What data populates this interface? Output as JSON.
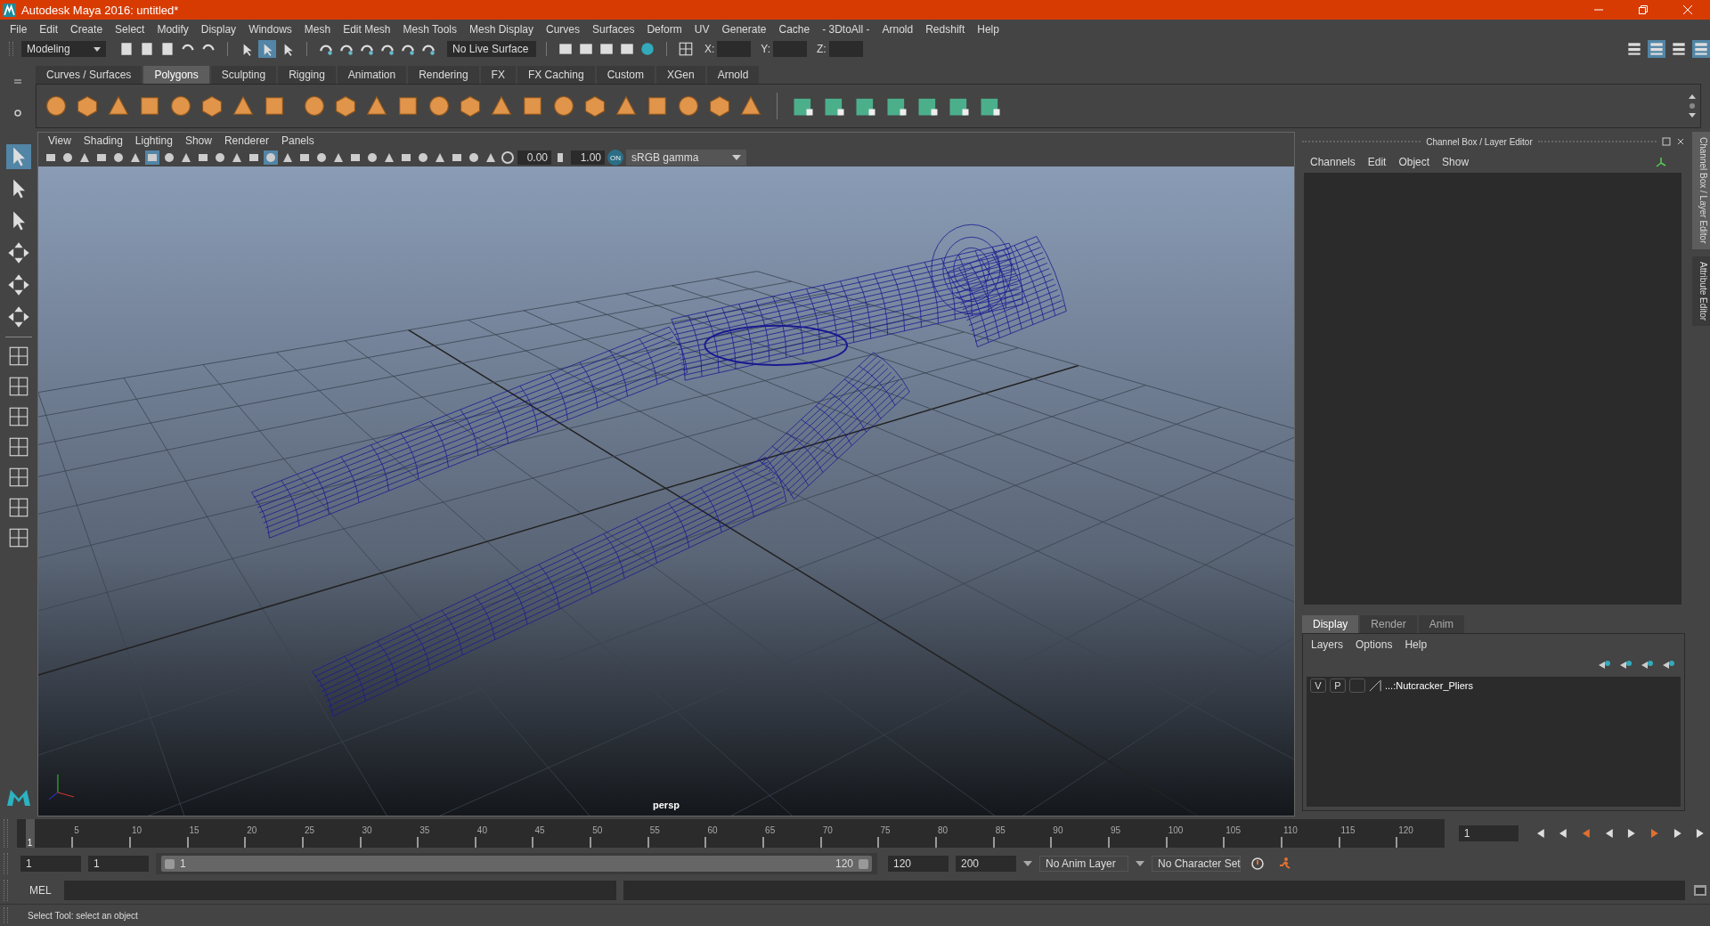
{
  "window": {
    "title": "Autodesk Maya 2016: untitled*"
  },
  "menu_bar": [
    "File",
    "Edit",
    "Create",
    "Select",
    "Modify",
    "Display",
    "Windows",
    "Mesh",
    "Edit Mesh",
    "Mesh Tools",
    "Mesh Display",
    "Curves",
    "Surfaces",
    "Deform",
    "UV",
    "Generate",
    "Cache",
    "- 3DtoAll -",
    "Arnold",
    "Redshift",
    "Help"
  ],
  "status_line": {
    "mode": "Modeling",
    "live_surface": "No Live Surface",
    "x_label": "X:",
    "y_label": "Y:",
    "z_label": "Z:"
  },
  "shelf_tabs": [
    {
      "label": "Curves / Surfaces",
      "selected": false
    },
    {
      "label": "Polygons",
      "selected": true
    },
    {
      "label": "Sculpting",
      "selected": false
    },
    {
      "label": "Rigging",
      "selected": false
    },
    {
      "label": "Animation",
      "selected": false
    },
    {
      "label": "Rendering",
      "selected": false
    },
    {
      "label": "FX",
      "selected": false
    },
    {
      "label": "FX Caching",
      "selected": false
    },
    {
      "label": "Custom",
      "selected": false
    },
    {
      "label": "XGen",
      "selected": false
    },
    {
      "label": "Arnold",
      "selected": false
    }
  ],
  "viewport": {
    "menus": [
      "View",
      "Shading",
      "Lighting",
      "Show",
      "Renderer",
      "Panels"
    ],
    "exposure": "0.00",
    "gamma": "1.00",
    "color_management": "ON",
    "color_space": "sRGB gamma",
    "camera": "persp"
  },
  "channel_box": {
    "title": "Channel Box / Layer Editor",
    "menus": [
      "Channels",
      "Edit",
      "Object",
      "Show"
    ]
  },
  "layer_editor": {
    "tabs": [
      {
        "label": "Display",
        "selected": true
      },
      {
        "label": "Render",
        "selected": false
      },
      {
        "label": "Anim",
        "selected": false
      }
    ],
    "menus": [
      "Layers",
      "Options",
      "Help"
    ],
    "layers": [
      {
        "visible": "V",
        "playback": "P",
        "name": "...:Nutcracker_Pliers"
      }
    ]
  },
  "side_tabs": [
    "Channel Box / Layer Editor",
    "Attribute Editor"
  ],
  "time_slider": {
    "ticks": [
      "5",
      "10",
      "15",
      "20",
      "25",
      "30",
      "35",
      "40",
      "45",
      "50",
      "55",
      "60",
      "65",
      "70",
      "75",
      "80",
      "85",
      "90",
      "95",
      "100",
      "105",
      "110",
      "115",
      "120"
    ],
    "current_frame": "1",
    "level": 0,
    "frame_field": "1"
  },
  "range_slider": {
    "start": "1",
    "playback_start": "1",
    "range_start": "1",
    "range_end": "120",
    "level": 1,
    "playback_end": "120",
    "end": "200",
    "anim_layer": "No Anim Layer",
    "character_set": "No Character Set"
  },
  "command_line": {
    "label": "MEL"
  },
  "help_line": {
    "text": "Select Tool: select an object"
  }
}
